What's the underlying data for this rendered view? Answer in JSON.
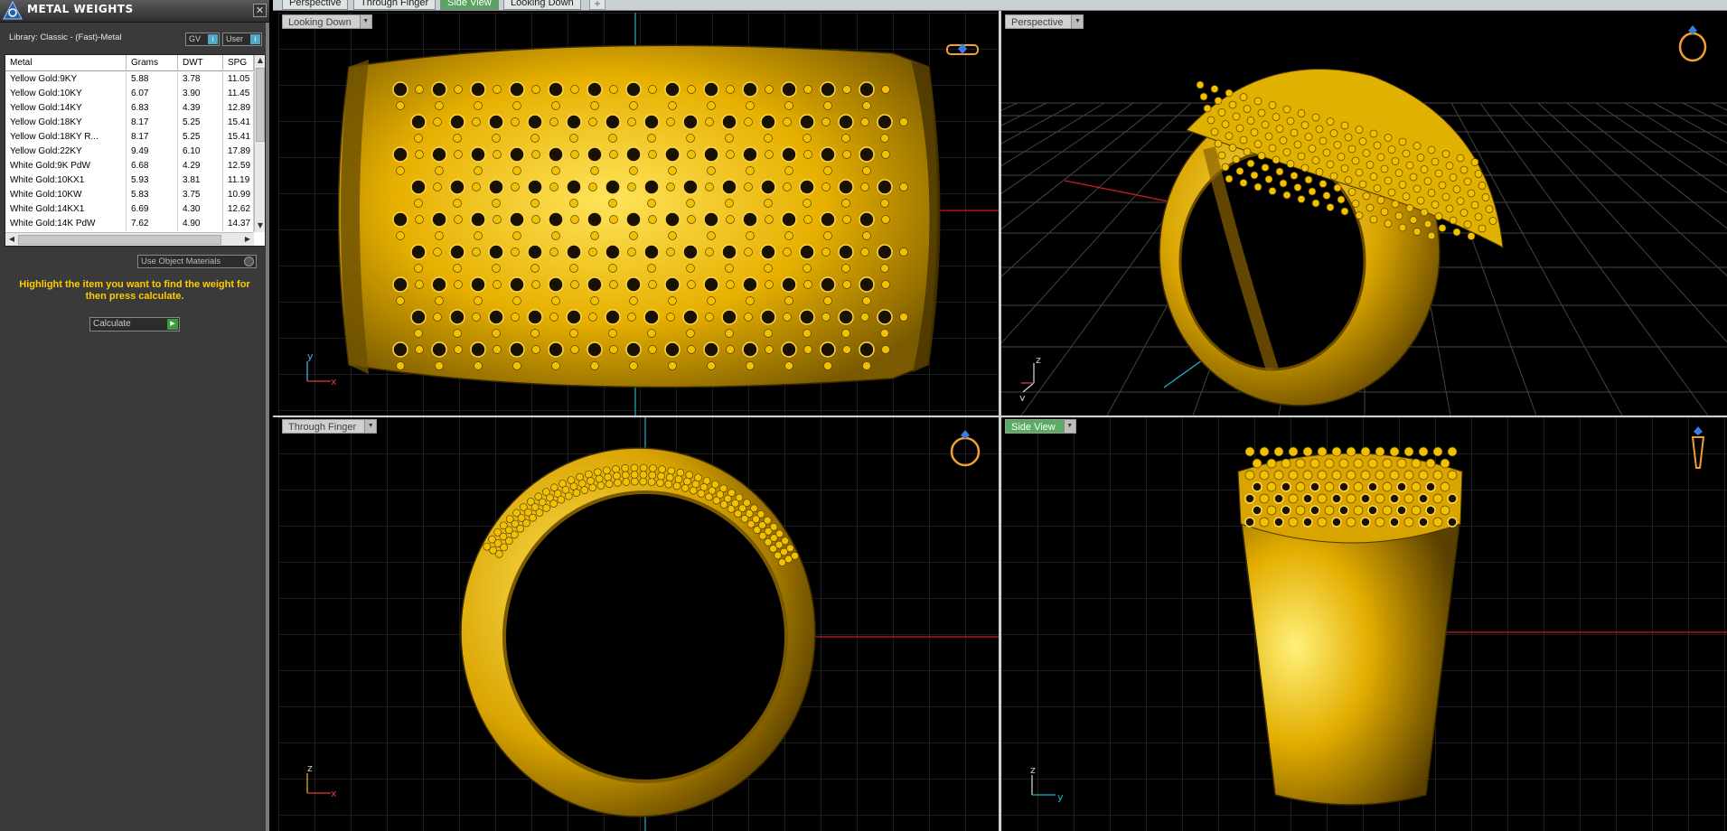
{
  "panel": {
    "title": "METAL WEIGHTS",
    "close_glyph": "✕",
    "library": "Library: Classic - (Fast)-Metal",
    "gv_label": "GV",
    "user_label": "User",
    "use_object_materials": "Use Object Materials",
    "hint": "Highlight the item you want to find the weight for then press calculate.",
    "calculate_label": "Calculate"
  },
  "table": {
    "headers": [
      "Metal",
      "Grams",
      "DWT",
      "SPG"
    ],
    "rows": [
      [
        "Yellow Gold:9KY",
        "5.88",
        "3.78",
        "11.05"
      ],
      [
        "Yellow Gold:10KY",
        "6.07",
        "3.90",
        "11.45"
      ],
      [
        "Yellow Gold:14KY",
        "6.83",
        "4.39",
        "12.89"
      ],
      [
        "Yellow Gold:18KY",
        "8.17",
        "5.25",
        "15.41"
      ],
      [
        "Yellow Gold:18KY R...",
        "8.17",
        "5.25",
        "15.41"
      ],
      [
        "Yellow Gold:22KY",
        "9.49",
        "6.10",
        "17.89"
      ],
      [
        "White Gold:9K PdW",
        "6.68",
        "4.29",
        "12.59"
      ],
      [
        "White Gold:10KX1",
        "5.93",
        "3.81",
        "11.19"
      ],
      [
        "White Gold:10KW",
        "5.83",
        "3.75",
        "10.99"
      ],
      [
        "White Gold:14KX1",
        "6.69",
        "4.30",
        "12.62"
      ],
      [
        "White Gold:14K PdW",
        "7.62",
        "4.90",
        "14.37"
      ]
    ]
  },
  "tabs": [
    {
      "label": "Perspective",
      "active": false
    },
    {
      "label": "Through Finger",
      "active": false
    },
    {
      "label": "Side View",
      "active": true
    },
    {
      "label": "Looking Down",
      "active": false
    }
  ],
  "viewports": {
    "top_left": {
      "label": "Looking Down",
      "axis_a": "y",
      "axis_b": "x"
    },
    "top_right": {
      "label": "Perspective",
      "axis_a": "z",
      "axis_b": "y"
    },
    "bottom_left": {
      "label": "Through Finger",
      "axis_a": "z",
      "axis_b": "x"
    },
    "bottom_right": {
      "label": "Side View",
      "axis_a": "z",
      "axis_b": "y"
    }
  },
  "colors": {
    "gold": "#f2c200",
    "gold_dark": "#7a5a00",
    "grid": "#3c3c3c",
    "axis_red": "#c81e1e",
    "axis_cyan": "#1fb2c4",
    "panel_bg": "#3a3a3a",
    "hint_yellow": "#ffcc00"
  },
  "icons": {
    "logo": "app-logo-icon",
    "ring_top": "ring-top-icon",
    "ring_persp": "ring-perspective-icon",
    "ring_front": "ring-front-icon",
    "ring_side": "ring-side-icon"
  }
}
